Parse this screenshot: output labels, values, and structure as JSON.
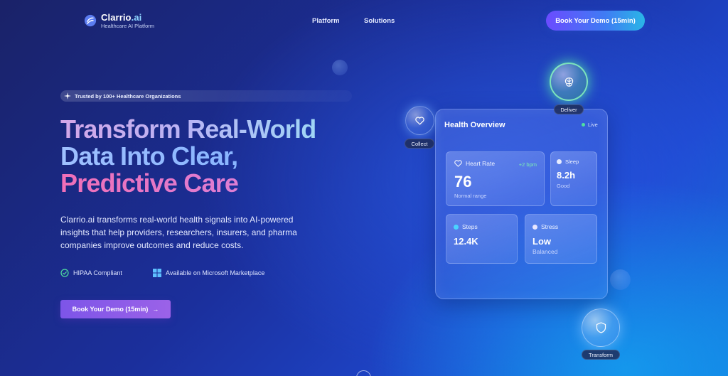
{
  "header": {
    "brand_name": "Clarrio",
    "brand_suffix": ".ai",
    "tagline": "Healthcare AI Platform",
    "nav": [
      "Platform",
      "Solutions"
    ],
    "cta_label": "Book Your Demo (15min)"
  },
  "hero": {
    "badge": "Trusted by 100+ Healthcare Organizations",
    "title_lines": [
      "Transform Real-World",
      "Data Into Clear,",
      "Predictive Care"
    ],
    "description": "Clarrio.ai transforms real-world health signals into AI-powered insights that help providers, researchers, insurers, and pharma companies improve outcomes and reduce costs.",
    "features": [
      "HIPAA Compliant",
      "Available on Microsoft Marketplace"
    ],
    "cta_label": "Book Your Demo (15min)",
    "cta_arrow": "→"
  },
  "bubbles": {
    "collect": "Collect",
    "deliver": "Deliver",
    "transform": "Transform"
  },
  "card": {
    "title": "Health Overview",
    "status": "Live",
    "heart_rate": {
      "label": "Heart Rate",
      "delta": "+2 bpm",
      "value": "76",
      "sub": "Normal range"
    },
    "sleep": {
      "label": "Sleep",
      "value": "8.2h",
      "sub": "Good"
    },
    "steps": {
      "label": "Steps",
      "value": "12.4K"
    },
    "stress": {
      "label": "Stress",
      "value": "Low",
      "sub": "Balanced"
    }
  },
  "colors": {
    "accent_cyan": "#8fd6ff",
    "live_green": "#4fe0a0",
    "hero_pink": "#f06fb8",
    "button_purple": "#7d55e8"
  },
  "icons": [
    "logo-icon",
    "sparkle-icon",
    "check-circle-icon",
    "windows-icon",
    "arrow-right-icon",
    "heart-icon",
    "brain-icon",
    "shield-icon"
  ]
}
